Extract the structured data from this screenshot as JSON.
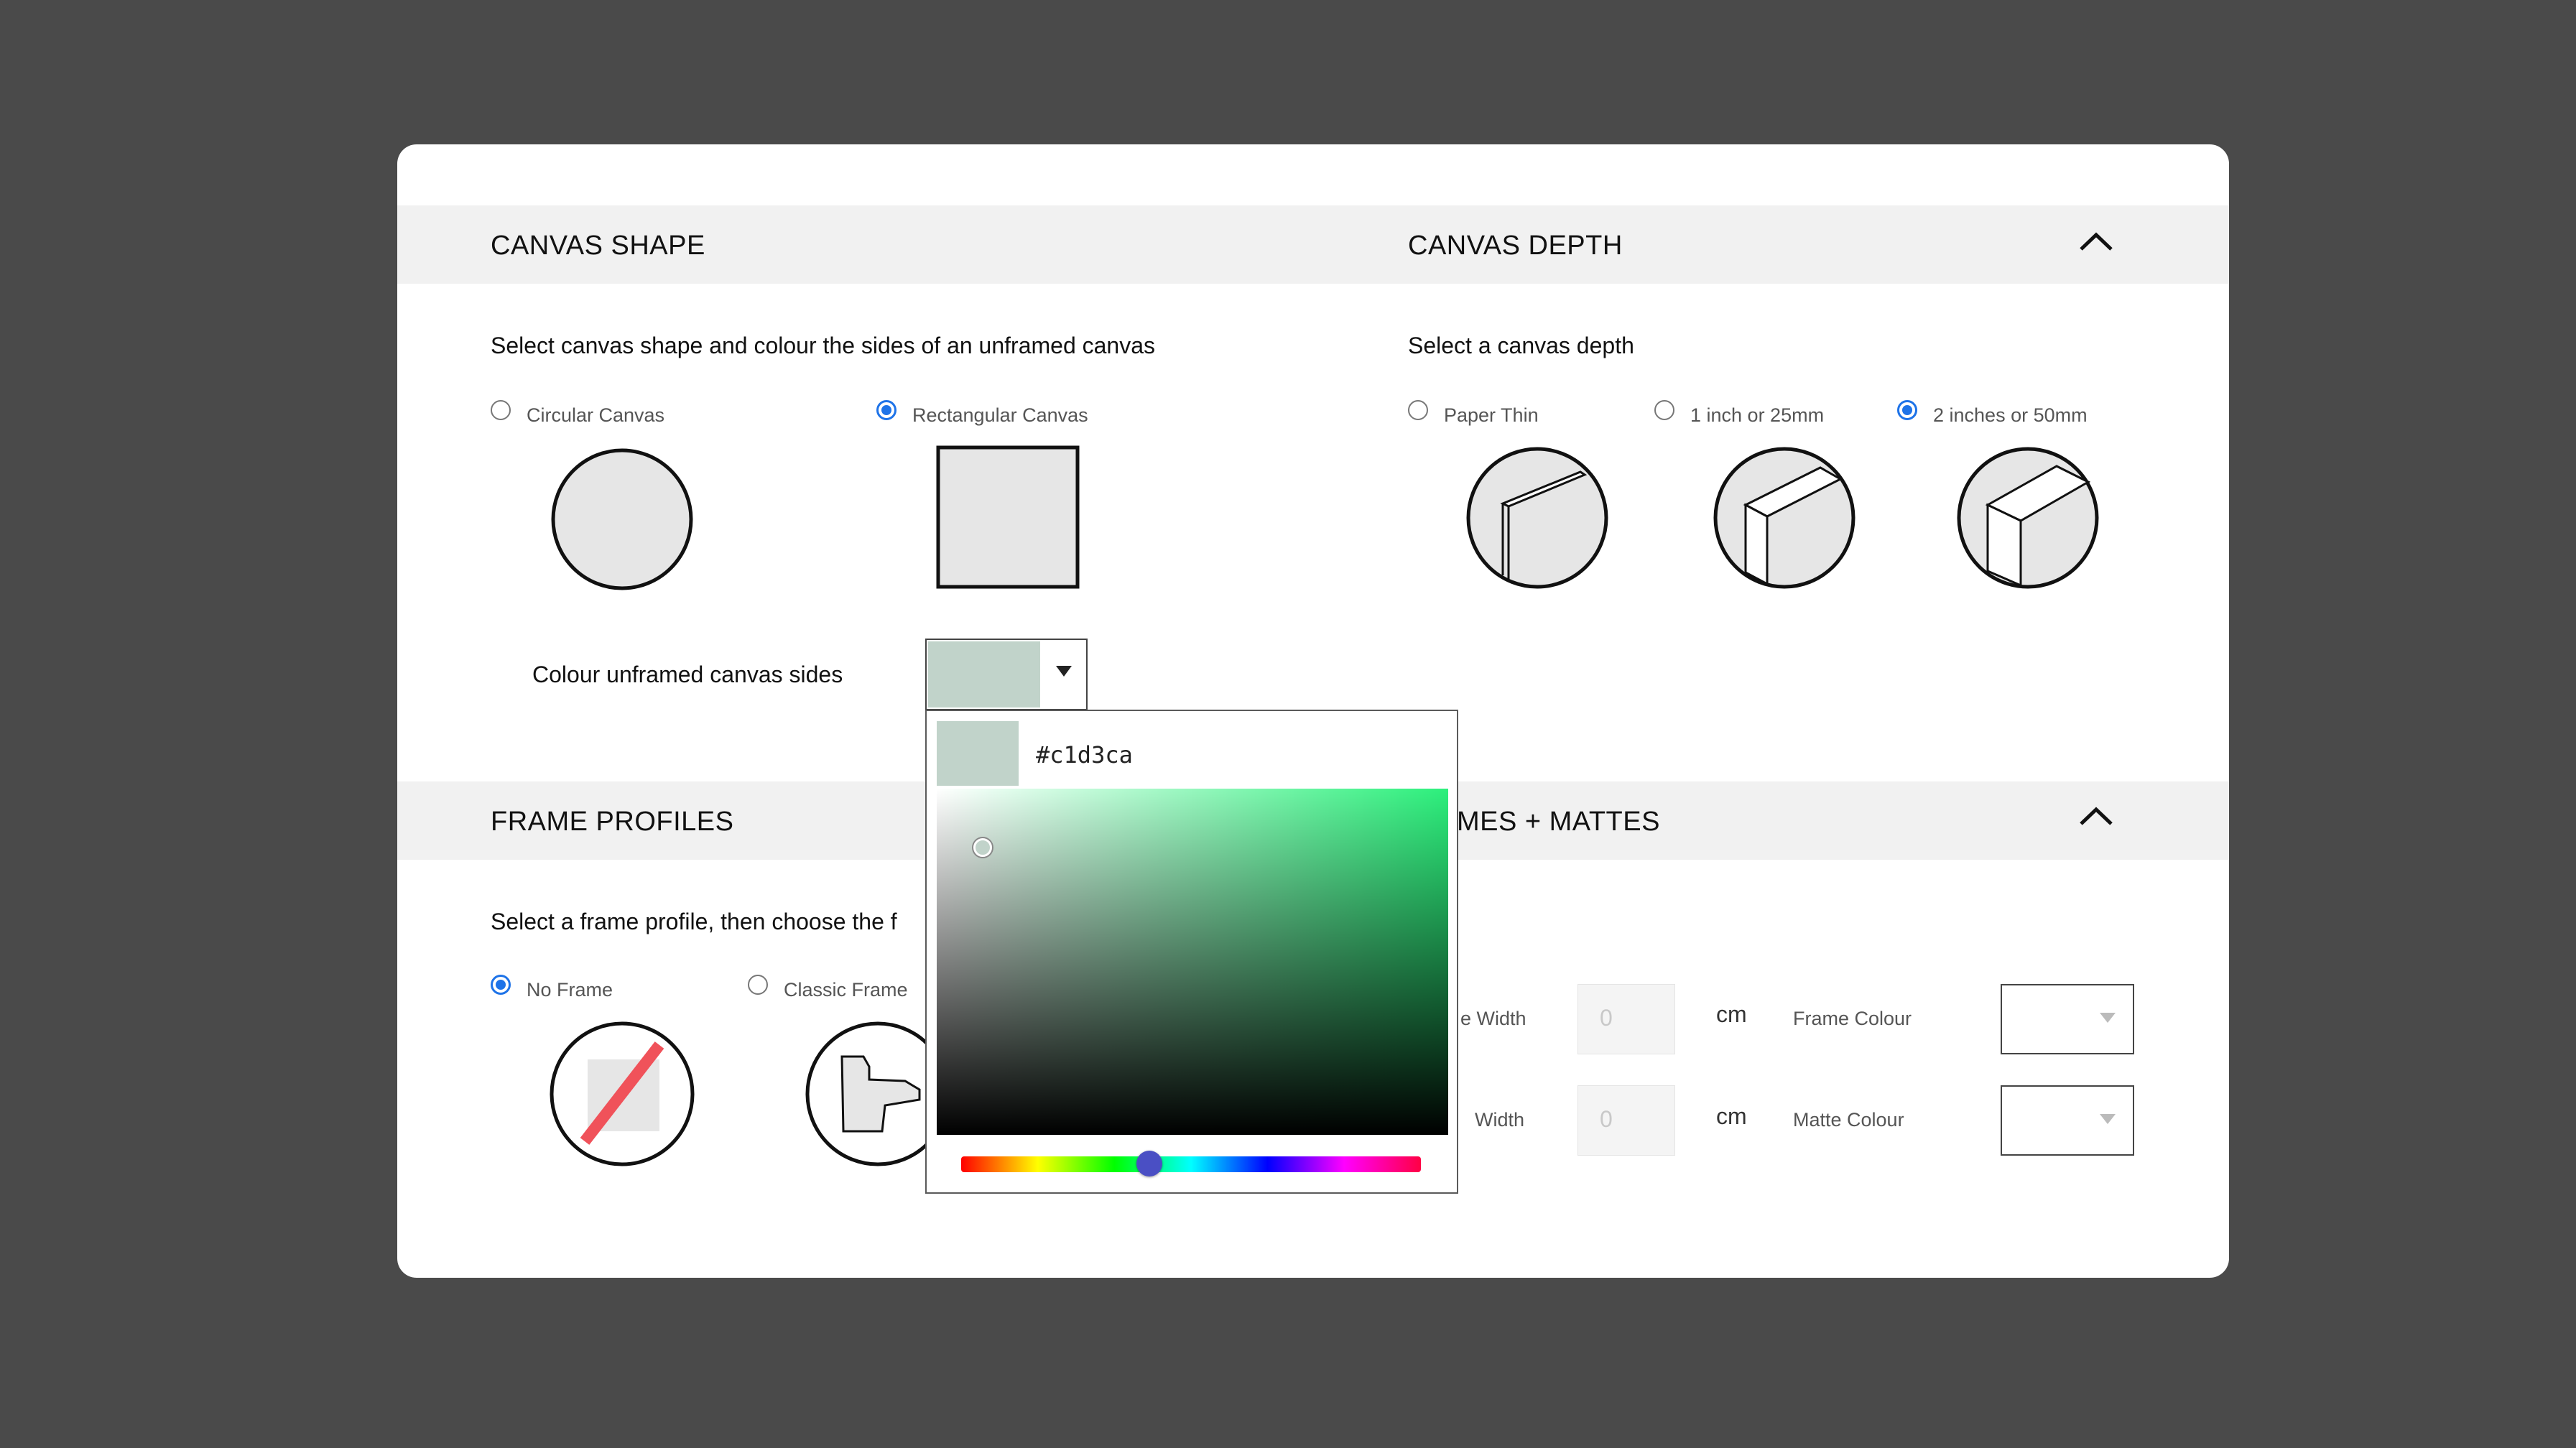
{
  "canvas_shape": {
    "title": "CANVAS SHAPE",
    "description": "Select canvas shape and colour the sides of an unframed canvas",
    "options": [
      {
        "label": "Circular Canvas",
        "selected": false
      },
      {
        "label": "Rectangular Canvas",
        "selected": true
      }
    ],
    "colour_label": "Colour unframed canvas sides",
    "colour_value": "#c1d3ca"
  },
  "canvas_depth": {
    "title": "CANVAS DEPTH",
    "description": "Select a canvas depth",
    "options": [
      {
        "label": "Paper Thin",
        "selected": false
      },
      {
        "label": "1 inch or 25mm",
        "selected": false
      },
      {
        "label": "2 inches or 50mm",
        "selected": true
      }
    ]
  },
  "frame_profiles": {
    "title": "FRAME PROFILES",
    "description": "Select a frame profile, then choose the f",
    "options": [
      {
        "label": "No Frame",
        "selected": true
      },
      {
        "label": "Classic Frame",
        "selected": false
      }
    ]
  },
  "frames_mattes": {
    "title": "MES + MATTES",
    "frame_width_label": "e Width",
    "frame_width_value": "0",
    "matte_width_label": "Width",
    "matte_width_value": "0",
    "unit": "cm",
    "frame_colour_label": "Frame Colour",
    "matte_colour_label": "Matte Colour"
  },
  "color_picker": {
    "hex": "#c1d3ca",
    "saturation": 0.09,
    "value": 0.83,
    "hue_position": 0.41
  },
  "colors": {
    "accent": "#1e73e8",
    "swatch": "#c1d3ca",
    "no_frame_slash": "#f0525a"
  }
}
